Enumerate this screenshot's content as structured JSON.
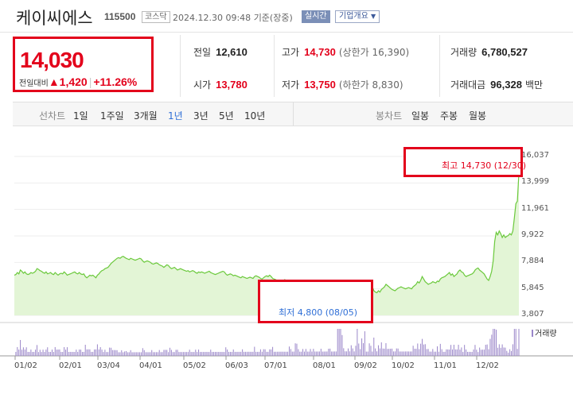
{
  "header": {
    "stock_name": "케이씨에스",
    "stock_code": "115500",
    "market_badge": "코스닥",
    "datetime": "2024.12.30 09:48",
    "status": "기준(장중)",
    "realtime_badge": "실시간",
    "company_button": "기업개요"
  },
  "price": {
    "current": "14,030",
    "change_label": "전일대비",
    "change_arrow": "▲",
    "change_amount": "1,420",
    "change_pct": "+11.26%"
  },
  "stats": {
    "prev_close_label": "전일",
    "prev_close": "12,610",
    "high_label": "고가",
    "high": "14,730",
    "upper_limit": "(상한가 16,390)",
    "volume_label": "거래량",
    "volume": "6,780,527",
    "open_label": "시가",
    "open": "13,780",
    "low_label": "저가",
    "low": "13,750",
    "lower_limit": "(하한가 8,830)",
    "amount_label": "거래대금",
    "amount": "96,328",
    "amount_unit": "백만"
  },
  "tabs": {
    "line_chart_label": "선차트",
    "periods": [
      "1일",
      "1주일",
      "3개월",
      "1년",
      "3년",
      "5년",
      "10년"
    ],
    "selected_period": "1년",
    "candle_chart_label": "봉차트",
    "candles": [
      "일봉",
      "주봉",
      "월봉"
    ]
  },
  "chart_data": {
    "type": "line",
    "y_ticks": [
      "16,037",
      "13,999",
      "11,961",
      "9,922",
      "7,884",
      "5,845",
      "3,807"
    ],
    "x_ticks": [
      "01/02",
      "02/01",
      "03/04",
      "04/01",
      "05/02",
      "06/03",
      "07/01",
      "08/01",
      "09/02",
      "10/02",
      "11/01",
      "12/02"
    ],
    "ylim": [
      3807,
      16037
    ],
    "max_label": "최고 14,730 (12/30)",
    "min_label": "최저 4,800 (08/05)",
    "volume_legend": "거래량",
    "colors": {
      "line": "#6bc93c",
      "fill": "#e3f5d6",
      "max": "#e3001b",
      "min": "#2f6fd6",
      "volume": "#9a86c9"
    },
    "series": [
      {
        "values": [
          6900,
          6950,
          7100,
          7000,
          7300,
          7200,
          7050,
          7150,
          7000,
          6950,
          7000,
          7100,
          7050,
          7100,
          7200,
          7400,
          7350,
          7250,
          7200,
          7100,
          7050,
          7150,
          7000,
          7050,
          7100,
          7000,
          6950,
          7100,
          7000,
          6900,
          7000,
          7050,
          7000,
          7150,
          7050,
          6900,
          6950,
          7000,
          7050,
          7100,
          7150,
          7050,
          7000,
          7100,
          7000,
          6950,
          7000,
          6800,
          6700,
          6800,
          6900,
          6850,
          6900,
          6800,
          6700,
          6900,
          7000,
          7150,
          7250,
          7300,
          7400,
          7450,
          7500,
          7650,
          7800,
          7900,
          8000,
          8100,
          8200,
          8250,
          8200,
          8300,
          8350,
          8280,
          8200,
          8150,
          8100,
          8200,
          8150,
          8100,
          8050,
          8100,
          8150,
          8200,
          8150,
          8000,
          7900,
          7950,
          8000,
          7950,
          7900,
          7800,
          7750,
          7800,
          7850,
          7800,
          7700,
          7650,
          7600,
          7500,
          7600,
          7700,
          7650,
          7500,
          7400,
          7450,
          7500,
          7400,
          7300,
          7350,
          7400,
          7350,
          7300,
          7250,
          7200,
          7250,
          7150,
          7200,
          7250,
          7200,
          7100,
          7050,
          7150,
          7100,
          7150,
          7100,
          7050,
          7100,
          7150,
          7200,
          7100,
          7050,
          7000,
          6950,
          7000,
          7050,
          7100,
          7150,
          7200,
          7150,
          7000,
          6900,
          6950,
          7000,
          6950,
          6850,
          6900,
          6850,
          6800,
          6750,
          6700,
          6800,
          6750,
          6700,
          6650,
          6700,
          6750,
          6700,
          6650,
          6800,
          6850,
          6800,
          6750,
          6650,
          6600,
          6700,
          6800,
          6850,
          6800,
          6900,
          6800,
          6650,
          6600,
          6550,
          6500,
          6450,
          6400,
          6450,
          6500,
          6550,
          6500,
          6450,
          6300,
          6200,
          6150,
          6100,
          6300,
          6500,
          6400,
          6350,
          6300,
          6200,
          6250,
          6150,
          6200,
          6250,
          6150,
          6100,
          6000,
          6050,
          6000,
          5950,
          6000,
          6100,
          6050,
          6000,
          5950,
          6000,
          5900,
          6000,
          5950,
          5900,
          5850,
          5800,
          5300,
          4800,
          5200,
          5500,
          5600,
          5650,
          5700,
          5600,
          5550,
          5700,
          5800,
          5850,
          5700,
          6200,
          6400,
          6300,
          6000,
          5800,
          6200,
          6150,
          6100,
          5900,
          6050,
          6000,
          5700,
          5600,
          5550,
          5700,
          5600,
          5800,
          5900,
          6000,
          6200,
          6100,
          6000,
          5900,
          5800,
          5750,
          5700,
          5800,
          5900,
          5950,
          6000,
          5950,
          5900,
          5850,
          5900,
          5950,
          5900,
          5850,
          6000,
          6100,
          6200,
          6400,
          6300,
          6500,
          6800,
          6600,
          6400,
          6300,
          6200,
          6250,
          6300,
          6400,
          6350,
          6300,
          6450,
          6400,
          6600,
          6700,
          6750,
          6800,
          6900,
          7000,
          7100,
          6900,
          7000,
          6800,
          6900,
          7000,
          7200,
          7300,
          7150,
          7100,
          6900,
          6800,
          6850,
          6900,
          6950,
          7000,
          7100,
          7300,
          7400,
          7450,
          7300,
          7200,
          7100,
          7000,
          6800,
          6600,
          6500,
          6800,
          7200,
          8000,
          9500,
          10200,
          10000,
          10300,
          10100,
          9800,
          10000,
          9800,
          9900,
          9950,
          10100,
          10000,
          10300,
          11300,
          12400,
          12600,
          14730
        ]
      }
    ]
  }
}
